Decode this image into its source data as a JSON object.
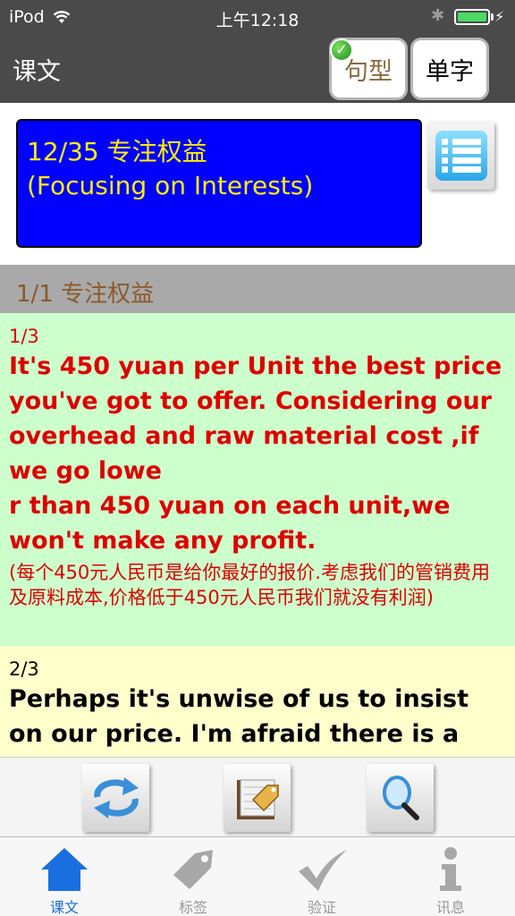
{
  "status_bar": {
    "carrier": "iPod",
    "time": "上午12:18"
  },
  "nav": {
    "title": "课文",
    "sentence_btn": "句型",
    "word_btn": "单字"
  },
  "lesson": {
    "line1": "12/35 专注权益",
    "line2": "(Focusing on Interests)"
  },
  "section": {
    "title": "1/1 专注权益"
  },
  "sentences": [
    {
      "index": "1/3",
      "english": "It's 450 yuan per Unit the best price you've got to offer. Considering our overhead and raw material cost ,if we go lowe\nr than 450 yuan on each unit,we won't make any profit.",
      "chinese": "(每个450元人民币是给你最好的报价.考虑我们的管销费用及原料成本,价格低于450元人民币我们就没有利润)"
    },
    {
      "index": "2/3",
      "english": "Perhaps it's unwise of us to insist on our price. I'm afraid there is a wide"
    }
  ],
  "tabs": [
    {
      "label": "课文",
      "icon": "home-icon"
    },
    {
      "label": "标签",
      "icon": "tag-icon"
    },
    {
      "label": "验证",
      "icon": "checkmark-icon"
    },
    {
      "label": "讯息",
      "icon": "info-icon"
    }
  ],
  "colors": {
    "accent": "#1a6fe0",
    "lesson_bg": "#0000ff",
    "lesson_text": "#ffee00",
    "sentence1_bg": "#ccffcc",
    "sentence2_bg": "#ffffcc",
    "highlight_text": "#dd0000"
  }
}
